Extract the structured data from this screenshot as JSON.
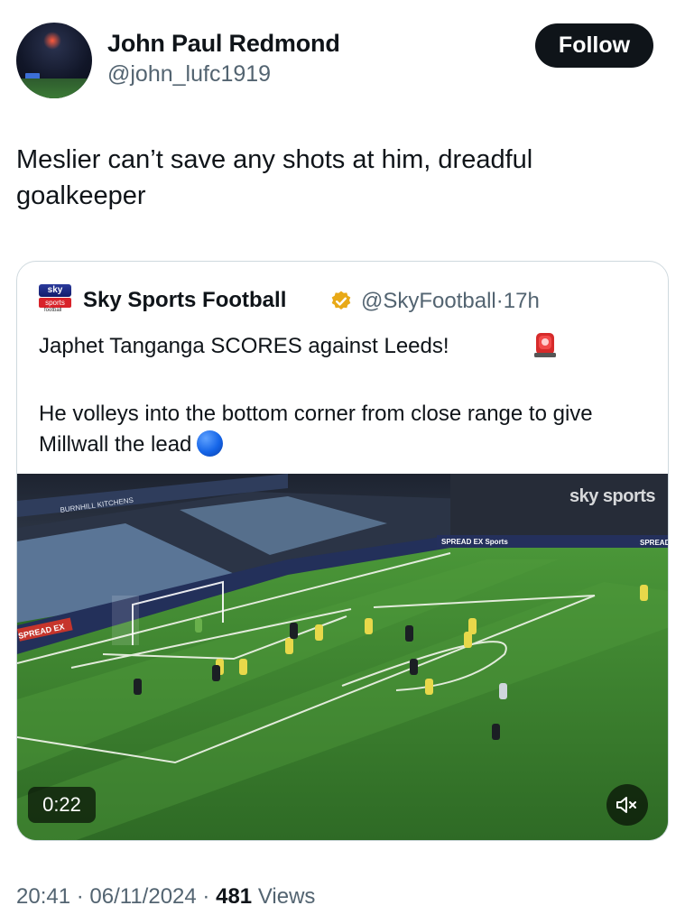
{
  "author": {
    "name": "John Paul Redmond",
    "handle": "@john_lufc1919"
  },
  "follow_label": "Follow",
  "tweet": {
    "text": "Meslier can’t save any shots at him, dreadful goalkeeper"
  },
  "quote": {
    "logo": {
      "line1": "sky",
      "line2": "sports",
      "line3": "football"
    },
    "name": "Sky Sports Football",
    "handle": "@SkyFootball",
    "separator": "·",
    "time": "17h",
    "text1": "Japhet Tanganga SCORES against Leeds!",
    "text2": "He volleys into the bottom corner from close range to give Millwall the lead",
    "video": {
      "duration": "0:22",
      "watermark": "sky sports",
      "boards": [
        "BURNHILL KITCHENS",
        "SPREAD EX",
        "SPREAD EX Sports",
        "SPREAD"
      ]
    }
  },
  "meta": {
    "time": "20:41",
    "sep1": "·",
    "date": "06/11/2024",
    "sep2": "·",
    "views": "481",
    "views_label": "Views"
  },
  "colors": {
    "text_primary": "#0f1419",
    "text_secondary": "#536471",
    "border": "#cfd9de",
    "follow_bg": "#0f1419",
    "verified_gold": "#e8a917",
    "pitch_green": "#3f8a2f"
  },
  "icons": [
    "verified-badge-icon",
    "siren-emoji-icon",
    "blue-circle-emoji-icon",
    "mute-icon"
  ]
}
